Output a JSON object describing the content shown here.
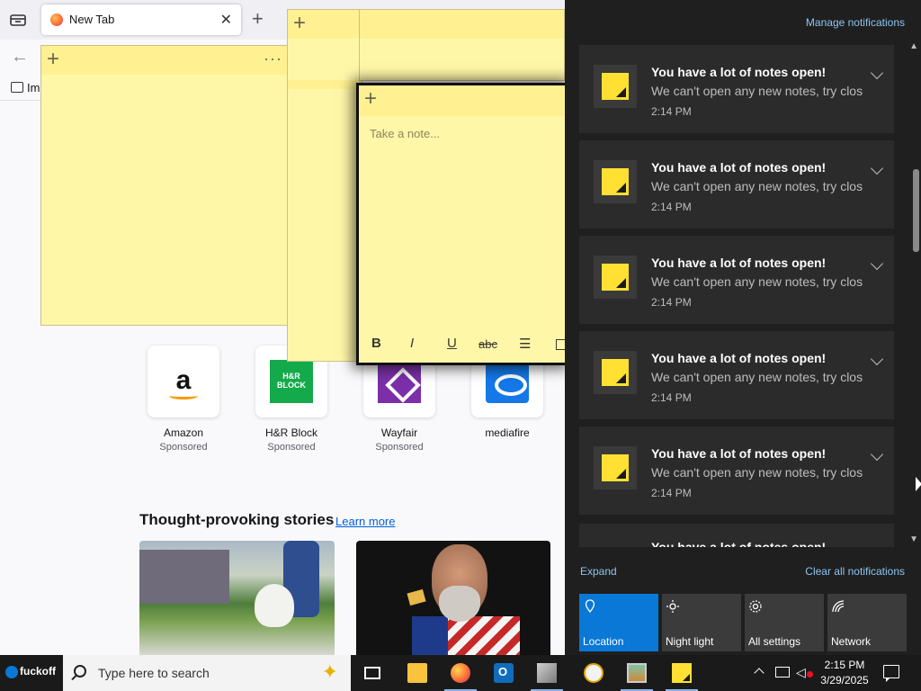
{
  "browser": {
    "tab_title": "New Tab",
    "bookmark_import": "Im",
    "shortcuts": [
      {
        "label": "Amazon",
        "sub": "Sponsored",
        "logo_text": "a"
      },
      {
        "label": "H&R Block",
        "sub": "Sponsored",
        "logo_text": "H&R BLOCK"
      },
      {
        "label": "Wayfair",
        "sub": "Sponsored"
      },
      {
        "label": "mediafire",
        "sub": ""
      }
    ],
    "stories_heading": "Thought-provoking stories",
    "learn_more": "Learn more"
  },
  "sticky_notes": {
    "placeholder": "Take a note...",
    "menu_glyph": "···",
    "add_glyph": "+",
    "toolbar": {
      "bold": "B",
      "italic": "I",
      "underline": "U",
      "strike": "abc",
      "list": "☰"
    }
  },
  "action_center": {
    "manage": "Manage notifications",
    "notifications": [
      {
        "title": "You have a lot of notes open!",
        "body": "We can't open any new notes, try clos",
        "time": "2:14 PM"
      },
      {
        "title": "You have a lot of notes open!",
        "body": "We can't open any new notes, try clos",
        "time": "2:14 PM"
      },
      {
        "title": "You have a lot of notes open!",
        "body": "We can't open any new notes, try clos",
        "time": "2:14 PM"
      },
      {
        "title": "You have a lot of notes open!",
        "body": "We can't open any new notes, try clos",
        "time": "2:14 PM"
      },
      {
        "title": "You have a lot of notes open!",
        "body": "We can't open any new notes, try clos",
        "time": "2:14 PM"
      }
    ],
    "partial_title": "You have a lot of notes open!",
    "expand": "Expand",
    "clear_all": "Clear all notifications",
    "quick_actions": [
      {
        "label": "Location",
        "icon": "location-icon",
        "active": true
      },
      {
        "label": "Night light",
        "icon": "brightness-icon",
        "active": false
      },
      {
        "label": "All settings",
        "icon": "gear-icon",
        "active": false
      },
      {
        "label": "Network",
        "icon": "network-icon",
        "active": false
      }
    ]
  },
  "taskbar": {
    "start_label": "fuckoff",
    "search_placeholder": "Type here to search",
    "time": "2:15 PM",
    "date": "3/29/2025"
  }
}
